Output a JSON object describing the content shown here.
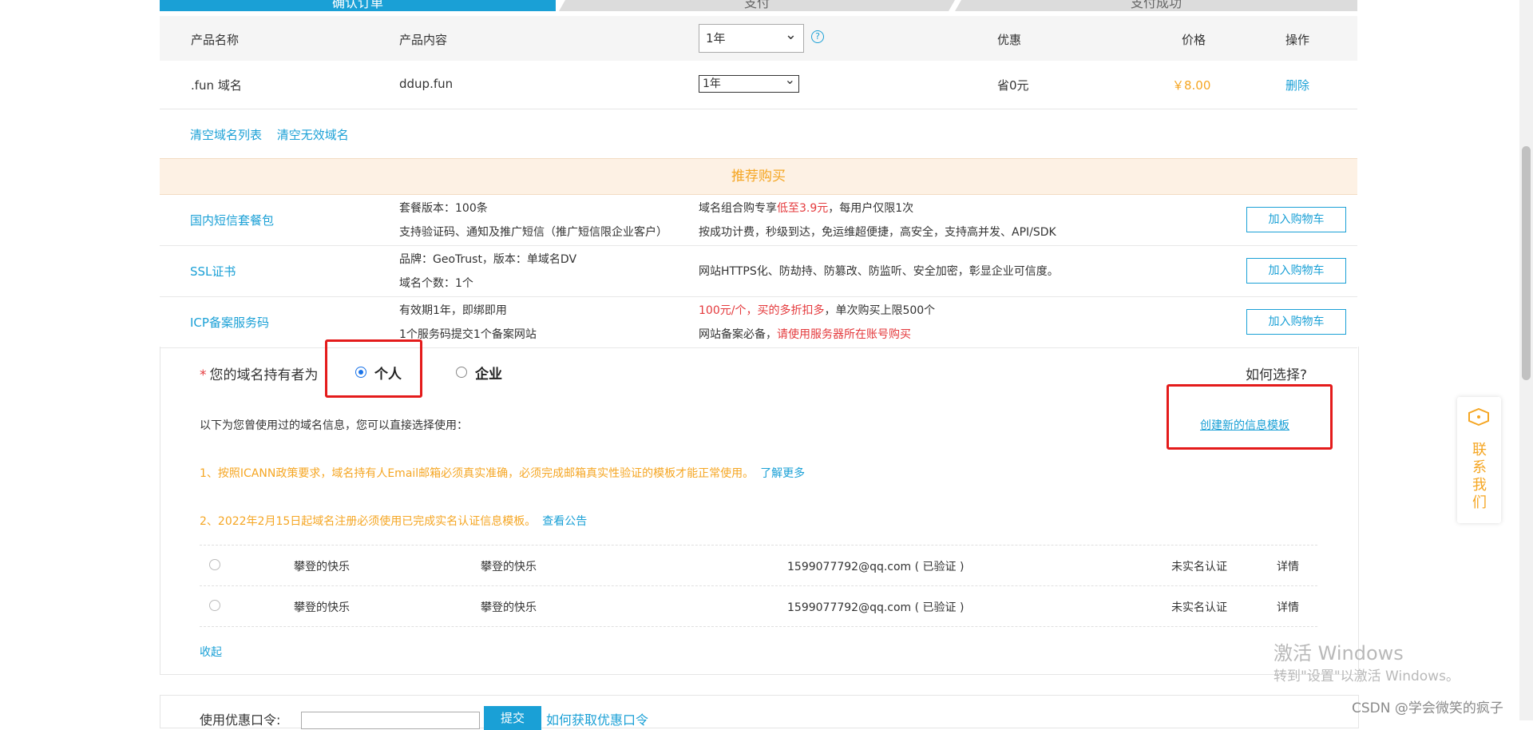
{
  "steps": [
    "确认订单",
    "支付",
    "支付成功"
  ],
  "table": {
    "headers": {
      "name": "产品名称",
      "content": "产品内容",
      "discount": "优惠",
      "price": "价格",
      "action": "操作"
    },
    "period_select_header": "1年",
    "row": {
      "name": ".fun 域名",
      "content": "ddup.fun",
      "period": "1年",
      "discount": "省0元",
      "price": "￥8.00",
      "action": "删除"
    }
  },
  "clear_links": {
    "clear_list": "清空域名列表",
    "clear_invalid": "清空无效域名"
  },
  "recommend": {
    "title": "推荐购买",
    "cart_label": "加入购物车",
    "items": [
      {
        "name": "国内短信套餐包",
        "left1": "套餐版本：100条",
        "left2": "支持验证码、通知及推广短信（推广短信限企业客户）",
        "right1_a": "域名组合购专享",
        "right1_b": "低至3.9元",
        "right1_c": "，每用户仅限1次",
        "right2": "按成功计费，秒级到达，免运维超便捷，高安全，支持高并发、API/SDK"
      },
      {
        "name": "SSL证书",
        "left1": "品牌：GeoTrust，版本：单域名DV",
        "left2": "域名个数：1个",
        "right": "网站HTTPS化、防劫持、防篡改、防监听、安全加密，彰显企业可信度。"
      },
      {
        "name": "ICP备案服务码",
        "left1": "有效期1年，即绑即用",
        "left2": "1个服务码提交1个备案网站",
        "right1_a": "100元/个，买的多折扣多",
        "right1_b": "，单次购买上限500个",
        "right2_a": "网站备案必备，",
        "right2_b": "请使用服务器所在账号购买"
      }
    ]
  },
  "holder": {
    "star": "*",
    "label": "您的域名持有者为",
    "options": [
      "个人",
      "企业"
    ],
    "selected": "个人",
    "how_to_choose": "如何选择?",
    "create_template": "创建新的信息模板",
    "info_text": "以下为您曾使用过的域名信息，您可以直接选择使用：",
    "notice1": "1、按照ICANN政策要求，域名持有人Email邮箱必须真实准确，必须完成邮箱真实性验证的模板才能正常使用。",
    "notice1_link": "了解更多",
    "notice2": "2、2022年2月15日起域名注册必须使用已完成实名认证信息模板。",
    "notice2_link": "查看公告",
    "templates": [
      {
        "name": "攀登的快乐",
        "org": "攀登的快乐",
        "email": "1599077792@qq.com ( 已验证 )",
        "status": "未实名认证",
        "detail": "详情"
      },
      {
        "name": "攀登的快乐",
        "org": "攀登的快乐",
        "email": "1599077792@qq.com ( 已验证 )",
        "status": "未实名认证",
        "detail": "详情"
      }
    ],
    "collapse": "收起"
  },
  "coupon": {
    "label": "使用优惠口令:",
    "submit": "提交",
    "how_link": "如何获取优惠口令"
  },
  "contact": {
    "icon": "contact-icon",
    "text": [
      "联",
      "系",
      "我",
      "们"
    ]
  },
  "watermark": {
    "line1": "激活 Windows",
    "line2": "转到\"设置\"以激活 Windows。",
    "csdn": "CSDN @学会微笑的疯子"
  },
  "colors": {
    "accent": "#1aa0d6",
    "orange": "#f5a623",
    "red": "#e4393c",
    "highlight": "#e41b1b"
  }
}
